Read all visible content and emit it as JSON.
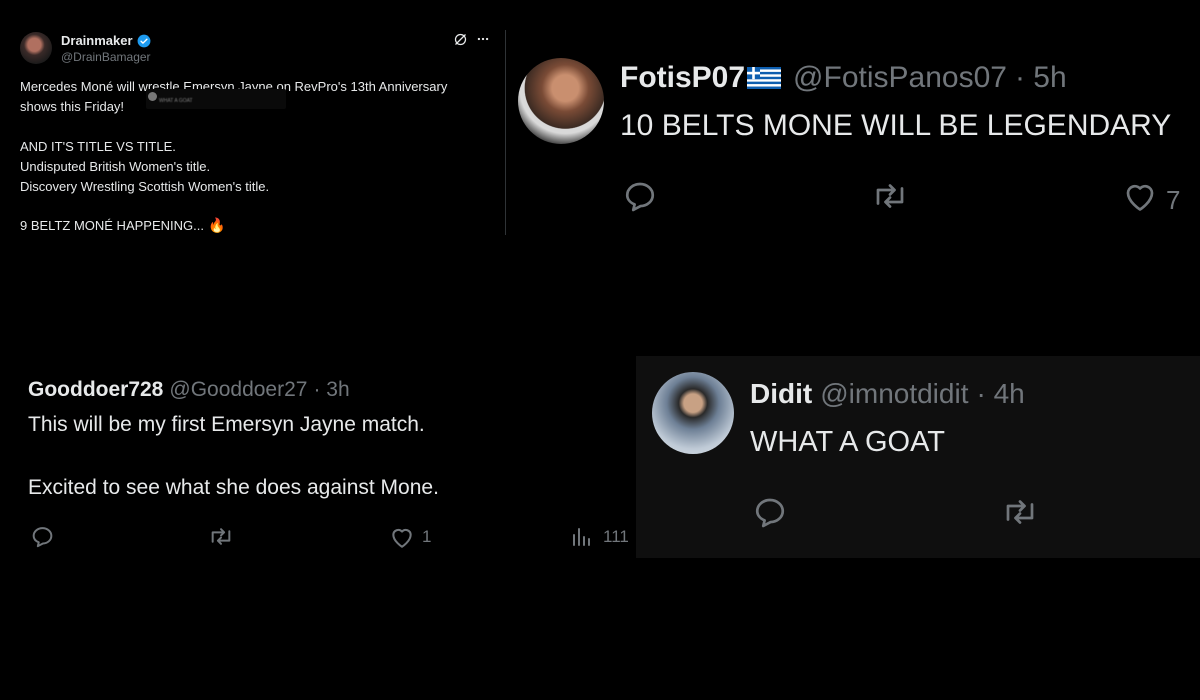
{
  "post_main": {
    "author_name": "Drainmaker",
    "author_handle": "@DrainBamager",
    "line1": "Mercedes Moné will wrestle Emersyn Jayne on RevPro's 13th Anniversary",
    "line2": "shows this Friday!",
    "line3": "AND IT'S TITLE VS TITLE.",
    "line4": "Undisputed British Women's title.",
    "line5": "Discovery Wrestling Scottish Women's title.",
    "line6": "9 BELTZ MONÉ HAPPENING...",
    "emoji": "🔥",
    "quoted_preview_text": "WHAT A GOAT"
  },
  "reply_fotis": {
    "name": "FotisP07",
    "flag": "🇬🇷",
    "handle": "@FotisPanos07",
    "time": "· 5h",
    "text": "10 BELTS MONE WILL BE LEGENDARY",
    "like_count": "7"
  },
  "reply_gooddoer": {
    "name": "Gooddoer728",
    "handle": "@Gooddoer27",
    "time": "· 3h",
    "text1": "This will be my first Emersyn Jayne match.",
    "text2": "Excited to see what she does against Mone.",
    "like_count": "1",
    "views_count": "111"
  },
  "reply_didit": {
    "name": "Didit",
    "handle": "@imnotdidit",
    "time": "· 4h",
    "text": "WHAT A GOAT"
  },
  "icons": [
    "verified-badge-icon",
    "grok-icon",
    "more-icon",
    "reply-icon",
    "retweet-icon",
    "like-icon",
    "views-icon"
  ],
  "colors": {
    "background": "#000000",
    "text": "#e7e9ea",
    "muted": "#71767b",
    "verified": "#1d9bf0",
    "flag_blue": "#0d5eaf"
  }
}
